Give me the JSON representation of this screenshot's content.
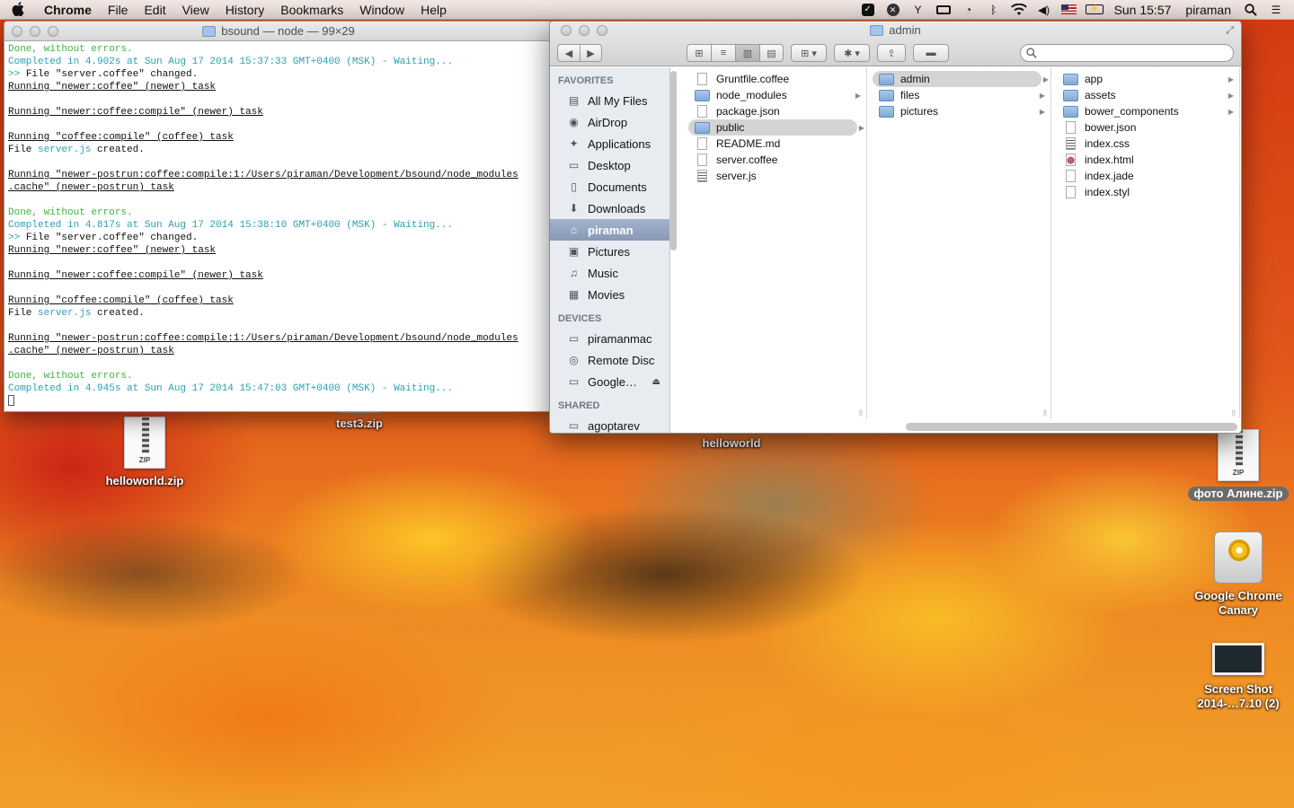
{
  "menubar": {
    "app_name": "Chrome",
    "items": [
      "File",
      "Edit",
      "View",
      "History",
      "Bookmarks",
      "Window",
      "Help"
    ],
    "clock": "Sun 15:57",
    "user": "piraman"
  },
  "terminal": {
    "title": "bsound — node — 99×29",
    "lines": [
      {
        "segments": [
          {
            "text": "Done, without errors.",
            "style": "green"
          }
        ]
      },
      {
        "segments": [
          {
            "text": "Completed in 4.902s at Sun Aug 17 2014 15:37:33 GMT+0400 (MSK) - Waiting...",
            "style": "cyan"
          }
        ]
      },
      {
        "segments": [
          {
            "text": ">> ",
            "style": "cyan"
          },
          {
            "text": "File \"server.coffee\" changed.",
            "style": ""
          }
        ]
      },
      {
        "segments": [
          {
            "text": "Running \"newer:coffee\" (newer) task",
            "style": "ul"
          }
        ]
      },
      {
        "segments": [
          {
            "text": "",
            "style": ""
          }
        ]
      },
      {
        "segments": [
          {
            "text": "Running \"newer:coffee:compile\" (newer) task",
            "style": "ul"
          }
        ]
      },
      {
        "segments": [
          {
            "text": "",
            "style": ""
          }
        ]
      },
      {
        "segments": [
          {
            "text": "Running \"coffee:compile\" (coffee) task",
            "style": "ul"
          }
        ]
      },
      {
        "segments": [
          {
            "text": "File ",
            "style": ""
          },
          {
            "text": "server.js",
            "style": "cyan"
          },
          {
            "text": " created.",
            "style": ""
          }
        ]
      },
      {
        "segments": [
          {
            "text": "",
            "style": ""
          }
        ]
      },
      {
        "segments": [
          {
            "text": "Running \"newer-postrun:coffee:compile:1:/Users/piraman/Development/bsound/node_modules",
            "style": "ul"
          }
        ]
      },
      {
        "segments": [
          {
            "text": ".cache\" (newer-postrun) task",
            "style": "ul"
          }
        ]
      },
      {
        "segments": [
          {
            "text": "",
            "style": ""
          }
        ]
      },
      {
        "segments": [
          {
            "text": "Done, without errors.",
            "style": "green"
          }
        ]
      },
      {
        "segments": [
          {
            "text": "Completed in 4.817s at Sun Aug 17 2014 15:38:10 GMT+0400 (MSK) - Waiting...",
            "style": "cyan"
          }
        ]
      },
      {
        "segments": [
          {
            "text": ">> ",
            "style": "cyan"
          },
          {
            "text": "File \"server.coffee\" changed.",
            "style": ""
          }
        ]
      },
      {
        "segments": [
          {
            "text": "Running \"newer:coffee\" (newer) task",
            "style": "ul"
          }
        ]
      },
      {
        "segments": [
          {
            "text": "",
            "style": ""
          }
        ]
      },
      {
        "segments": [
          {
            "text": "Running \"newer:coffee:compile\" (newer) task",
            "style": "ul"
          }
        ]
      },
      {
        "segments": [
          {
            "text": "",
            "style": ""
          }
        ]
      },
      {
        "segments": [
          {
            "text": "Running \"coffee:compile\" (coffee) task",
            "style": "ul"
          }
        ]
      },
      {
        "segments": [
          {
            "text": "File ",
            "style": ""
          },
          {
            "text": "server.js",
            "style": "cyan"
          },
          {
            "text": " created.",
            "style": ""
          }
        ]
      },
      {
        "segments": [
          {
            "text": "",
            "style": ""
          }
        ]
      },
      {
        "segments": [
          {
            "text": "Running \"newer-postrun:coffee:compile:1:/Users/piraman/Development/bsound/node_modules",
            "style": "ul"
          }
        ]
      },
      {
        "segments": [
          {
            "text": ".cache\" (newer-postrun) task",
            "style": "ul"
          }
        ]
      },
      {
        "segments": [
          {
            "text": "",
            "style": ""
          }
        ]
      },
      {
        "segments": [
          {
            "text": "Done, without errors.",
            "style": "green"
          }
        ]
      },
      {
        "segments": [
          {
            "text": "Completed in 4.945s at Sun Aug 17 2014 15:47:03 GMT+0400 (MSK) - Waiting...",
            "style": "cyan"
          }
        ]
      }
    ]
  },
  "finder": {
    "title": "admin",
    "sidebar": {
      "favorites_heading": "FAVORITES",
      "favorites": [
        {
          "label": "All My Files",
          "icon": "all-files-icon",
          "glyph": "▤",
          "selected": false
        },
        {
          "label": "AirDrop",
          "icon": "airdrop-icon",
          "glyph": "◉",
          "selected": false
        },
        {
          "label": "Applications",
          "icon": "applications-icon",
          "glyph": "✦",
          "selected": false
        },
        {
          "label": "Desktop",
          "icon": "desktop-icon",
          "glyph": "▭",
          "selected": false
        },
        {
          "label": "Documents",
          "icon": "documents-icon",
          "glyph": "▯",
          "selected": false
        },
        {
          "label": "Downloads",
          "icon": "downloads-icon",
          "glyph": "⬇",
          "selected": false
        },
        {
          "label": "piraman",
          "icon": "home-icon",
          "glyph": "⌂",
          "selected": true
        },
        {
          "label": "Pictures",
          "icon": "pictures-icon",
          "glyph": "▣",
          "selected": false
        },
        {
          "label": "Music",
          "icon": "music-icon",
          "glyph": "♫",
          "selected": false
        },
        {
          "label": "Movies",
          "icon": "movies-icon",
          "glyph": "▦",
          "selected": false
        }
      ],
      "devices_heading": "DEVICES",
      "devices": [
        {
          "label": "piramanmac",
          "icon": "laptop-icon",
          "glyph": "▭",
          "eject": false
        },
        {
          "label": "Remote Disc",
          "icon": "disc-icon",
          "glyph": "◎",
          "eject": false
        },
        {
          "label": "Google…",
          "icon": "drive-icon",
          "glyph": "▭",
          "eject": true
        }
      ],
      "shared_heading": "SHARED",
      "shared": [
        {
          "label": "agoptarev",
          "icon": "network-computer-icon",
          "glyph": "▭"
        }
      ]
    },
    "columns": [
      {
        "items": [
          {
            "name": "Gruntfile.coffee",
            "kind": "file",
            "selected": false,
            "has_children": false
          },
          {
            "name": "node_modules",
            "kind": "folder",
            "selected": false,
            "has_children": true
          },
          {
            "name": "package.json",
            "kind": "file",
            "selected": false,
            "has_children": false
          },
          {
            "name": "public",
            "kind": "folder",
            "selected": true,
            "has_children": true
          },
          {
            "name": "README.md",
            "kind": "file",
            "selected": false,
            "has_children": false
          },
          {
            "name": "server.coffee",
            "kind": "file",
            "selected": false,
            "has_children": false
          },
          {
            "name": "server.js",
            "kind": "file-dark",
            "selected": false,
            "has_children": false
          }
        ]
      },
      {
        "items": [
          {
            "name": "admin",
            "kind": "folder",
            "selected": true,
            "has_children": true
          },
          {
            "name": "files",
            "kind": "folder",
            "selected": false,
            "has_children": true
          },
          {
            "name": "pictures",
            "kind": "folder",
            "selected": false,
            "has_children": true
          }
        ]
      },
      {
        "items": [
          {
            "name": "app",
            "kind": "folder",
            "selected": false,
            "has_children": true
          },
          {
            "name": "assets",
            "kind": "folder",
            "selected": false,
            "has_children": true
          },
          {
            "name": "bower_components",
            "kind": "folder",
            "selected": false,
            "has_children": true
          },
          {
            "name": "bower.json",
            "kind": "file",
            "selected": false,
            "has_children": false
          },
          {
            "name": "index.css",
            "kind": "file-dark",
            "selected": false,
            "has_children": false
          },
          {
            "name": "index.html",
            "kind": "file-chrome",
            "selected": false,
            "has_children": false
          },
          {
            "name": "index.jade",
            "kind": "file",
            "selected": false,
            "has_children": false
          },
          {
            "name": "index.styl",
            "kind": "file",
            "selected": false,
            "has_children": false
          }
        ]
      }
    ]
  },
  "desktop": {
    "icons": {
      "helloworld_zip": {
        "label": "helloworld.zip",
        "tag": "ZIP"
      },
      "test3_zip": {
        "label": "test3.zip"
      },
      "helloworld": {
        "label": "helloworld"
      },
      "foto_zip": {
        "label": "фото Алине.zip",
        "tag": "ZIP"
      },
      "chrome_canary": {
        "label_line1": "Google Chrome",
        "label_line2": "Canary"
      },
      "screenshot": {
        "label_line1": "Screen Shot",
        "label_line2": "2014-…7.10 (2)"
      }
    }
  }
}
